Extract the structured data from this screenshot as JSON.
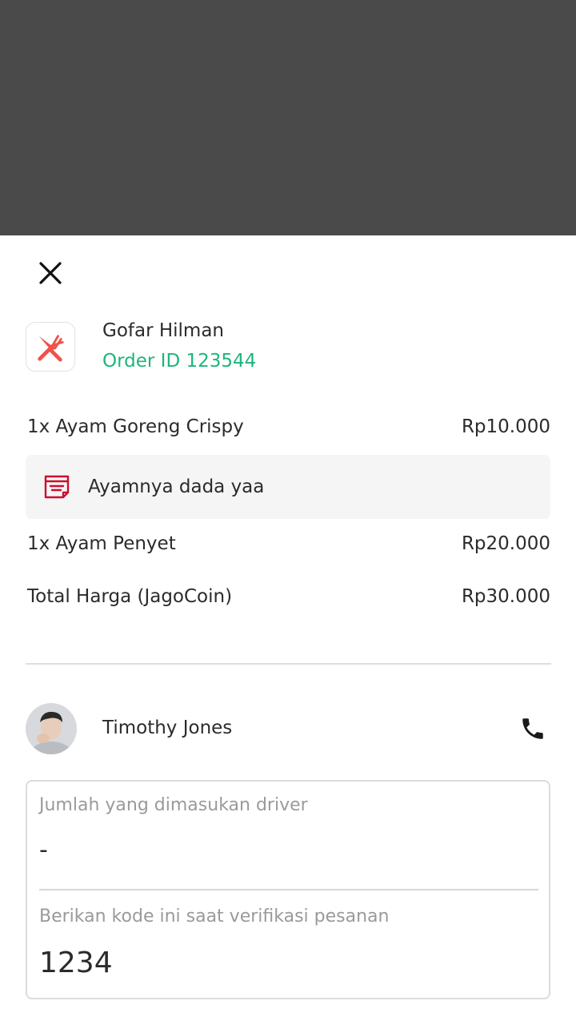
{
  "order": {
    "merchant_name": "Gofar Hilman",
    "order_id": "Order ID 123544",
    "items": [
      {
        "name": "1x Ayam Goreng Crispy",
        "price": "Rp10.000"
      },
      {
        "name": "1x Ayam Penyet",
        "price": "Rp20.000"
      }
    ],
    "note": "Ayamnya dada yaa",
    "total_label": "Total Harga (JagoCoin)",
    "total_value": "Rp30.000"
  },
  "driver": {
    "name": "Timothy Jones"
  },
  "info_card": {
    "amount_label": "Jumlah yang dimasukan driver",
    "amount_value": "-",
    "code_label": "Berikan kode ini saat verifikasi pesanan",
    "code_value": "1234"
  },
  "icons": {
    "close": "close-icon",
    "merchant": "fork-knife-icon",
    "note": "note-icon",
    "phone": "phone-icon",
    "avatar": "avatar"
  },
  "colors": {
    "accent_green": "#1fb57a",
    "icon_red": "#f0524a",
    "note_icon_red": "#c8102e",
    "overlay": "#4a4a4a"
  }
}
